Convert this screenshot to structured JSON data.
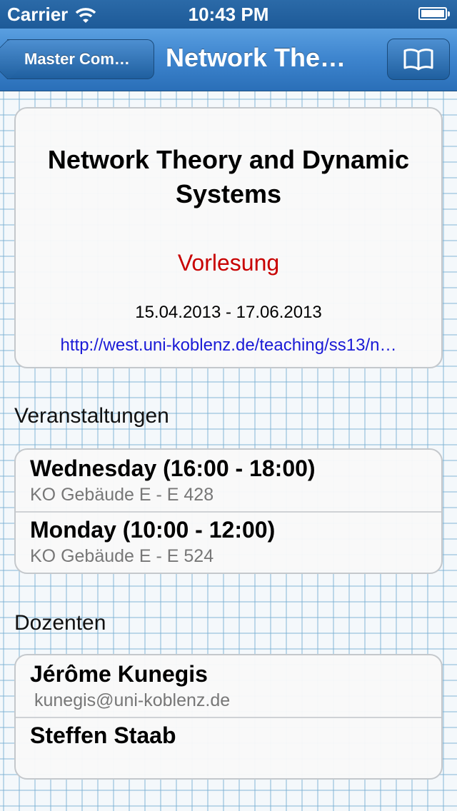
{
  "status": {
    "carrier": "Carrier",
    "time": "10:43 PM"
  },
  "nav": {
    "back_label": "Master Com…",
    "title": "Network The…"
  },
  "course": {
    "title": "Network Theory and Dynamic Systems",
    "type": "Vorlesung",
    "dates": "15.04.2013 - 17.06.2013",
    "url": "http://west.uni-koblenz.de/teaching/ss13/n…"
  },
  "veranstaltungen": {
    "header": "Veranstaltungen",
    "items": [
      {
        "time": "Wednesday (16:00 - 18:00)",
        "room": "KO Gebäude E - E 428"
      },
      {
        "time": "Monday (10:00 - 12:00)",
        "room": "KO Gebäude E - E 524"
      }
    ]
  },
  "dozenten": {
    "header": "Dozenten",
    "items": [
      {
        "name": "Jérôme Kunegis",
        "email": "kunegis@uni-koblenz.de"
      },
      {
        "name": "Steffen Staab",
        "email": ""
      }
    ]
  },
  "colors": {
    "nav_blue": "#3f86cf",
    "type_red": "#c80000",
    "link_blue": "#1a1ad6"
  }
}
